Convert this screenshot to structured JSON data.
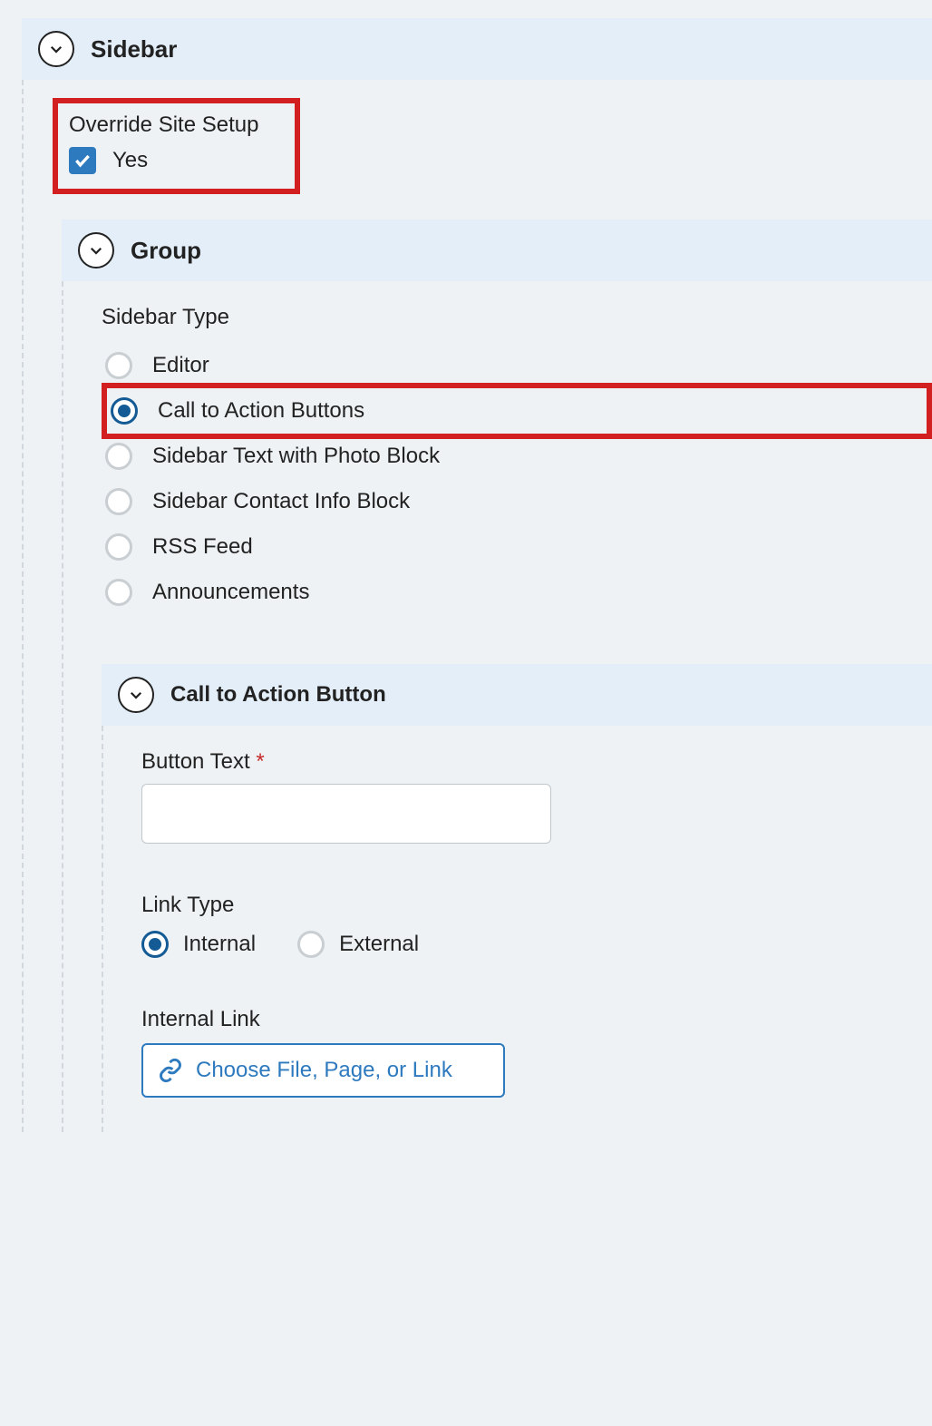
{
  "sections": {
    "sidebar": {
      "title": "Sidebar"
    },
    "group": {
      "title": "Group"
    },
    "cta": {
      "title": "Call to Action Button"
    }
  },
  "override": {
    "label": "Override Site Setup",
    "checkbox_label": "Yes",
    "checked": true
  },
  "sidebar_type": {
    "label": "Sidebar Type",
    "options": [
      {
        "label": "Editor",
        "selected": false
      },
      {
        "label": "Call to Action Buttons",
        "selected": true,
        "highlight": true
      },
      {
        "label": "Sidebar Text with Photo Block",
        "selected": false
      },
      {
        "label": "Sidebar Contact Info Block",
        "selected": false
      },
      {
        "label": "RSS Feed",
        "selected": false
      },
      {
        "label": "Announcements",
        "selected": false
      }
    ]
  },
  "cta_fields": {
    "button_text_label": "Button Text",
    "button_text_value": "",
    "required_marker": "*",
    "link_type_label": "Link Type",
    "link_type_options": [
      {
        "label": "Internal",
        "selected": true
      },
      {
        "label": "External",
        "selected": false
      }
    ],
    "internal_link_label": "Internal Link",
    "choose_button_label": "Choose File, Page, or Link"
  }
}
